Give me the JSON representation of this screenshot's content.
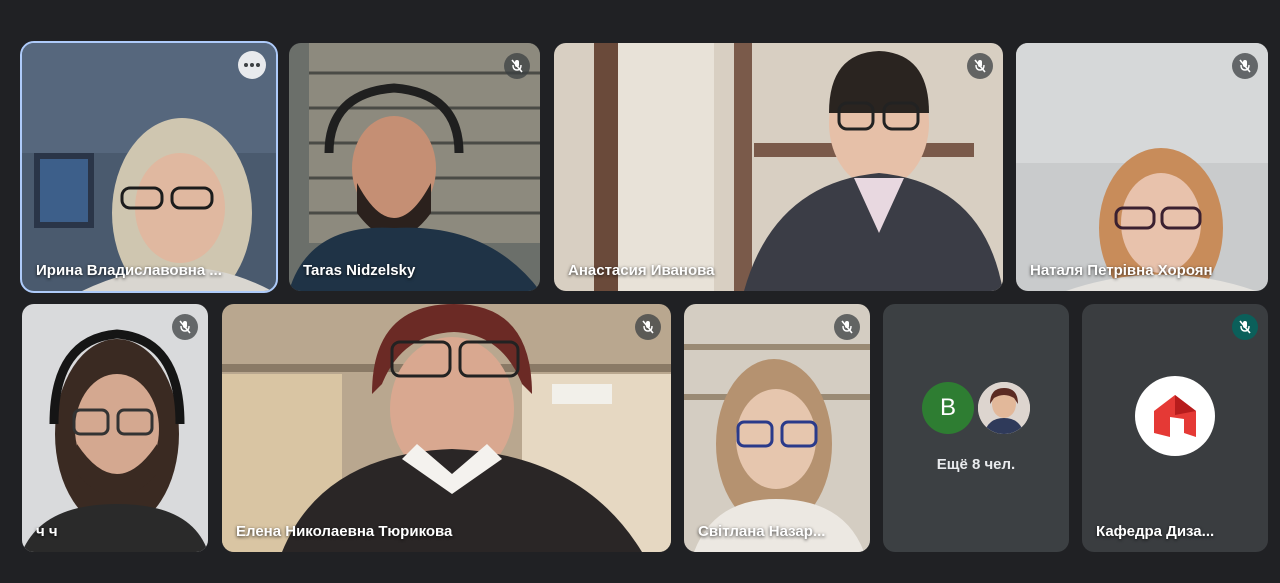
{
  "meeting": {
    "participants": [
      {
        "name": "Ирина Владиславовна ...",
        "muted": false,
        "active_speaker": true
      },
      {
        "name": "Taras Nidzelsky",
        "muted": true
      },
      {
        "name": "Анастасия Иванова",
        "muted": true
      },
      {
        "name": "Наталя Петрівна Хороян",
        "muted": true
      },
      {
        "name": "ч ч",
        "muted": true
      },
      {
        "name": "Елена Николаевна Тюрикова",
        "muted": true
      },
      {
        "name": "Світлана Назар...",
        "muted": true
      },
      {
        "name": "Кафедра Диза...",
        "muted": true
      }
    ],
    "overflow": {
      "avatar_letter": "B",
      "label": "Ещё 8 чел."
    }
  },
  "colors": {
    "background": "#202124",
    "active_outline": "#aecbfa",
    "avatar_green": "#2e7d32",
    "logo_red": "#e53935"
  },
  "icons": {
    "mute": "mic-off-icon",
    "options": "more-options-icon",
    "logo": "house-logo-icon"
  }
}
